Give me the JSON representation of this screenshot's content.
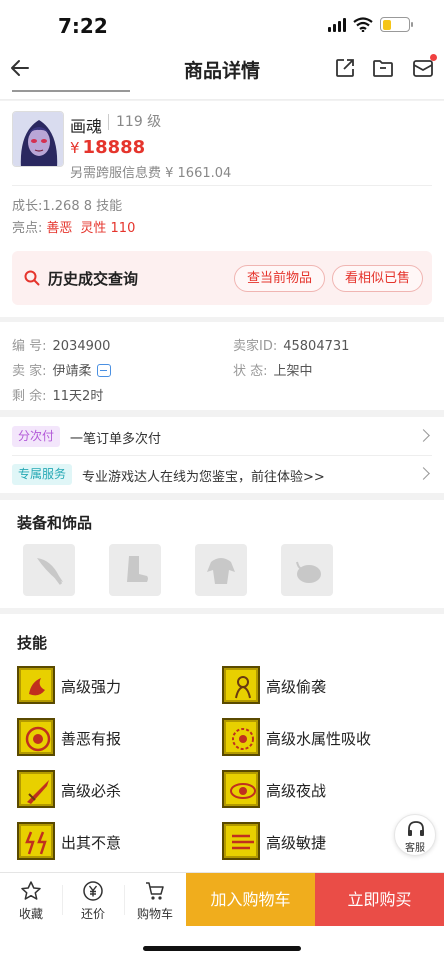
{
  "status": {
    "time": "7:22"
  },
  "nav": {
    "title": "商品详情"
  },
  "product": {
    "name": "画魂",
    "level": "119 级",
    "price_symbol": "¥",
    "price": "18888",
    "fee": "另需跨服信息费 ¥ 1661.04",
    "growth": "成长:1.268 8 技能",
    "highlight_label": "亮点:",
    "highlights": [
      "善恶",
      "灵性 110"
    ]
  },
  "history": {
    "title": "历史成交查询",
    "btn_current": "查当前物品",
    "btn_similar": "看相似已售"
  },
  "info": {
    "sn_label": "编 号:",
    "sn": "2034900",
    "seller_id_label": "卖家ID:",
    "seller_id": "45804731",
    "seller_label": "卖 家:",
    "seller": "伊靖柔",
    "status_label": "状 态:",
    "status": "上架中",
    "remain_label": "剩 余:",
    "remain": "11天2时"
  },
  "services": [
    {
      "tag": "分次付",
      "text": "一笔订单多次付"
    },
    {
      "tag": "专属服务",
      "text": "专业游戏达人在线为您鉴宝，前往体验>>"
    }
  ],
  "equipment": {
    "title": "装备和饰品",
    "slots": [
      "weapon-slot-icon",
      "boot-slot-icon",
      "armor-slot-icon",
      "accessory-slot-icon"
    ]
  },
  "skills": {
    "title": "技能",
    "items": [
      {
        "name": "高级强力"
      },
      {
        "name": "高级偷袭"
      },
      {
        "name": "善恶有报"
      },
      {
        "name": "高级水属性吸收"
      },
      {
        "name": "高级必杀"
      },
      {
        "name": "高级夜战"
      },
      {
        "name": "出其不意"
      },
      {
        "name": "高级敏捷"
      }
    ]
  },
  "customer_service": {
    "label": "客服"
  },
  "bottom": {
    "collect": "收藏",
    "bargain": "还价",
    "cart": "购物车",
    "add_cart": "加入购物车",
    "buy_now": "立即购买"
  },
  "colors": {
    "accent_red": "#e5342c",
    "cart_button": "#f0ad1d",
    "buy_button": "#ea4d47",
    "skill_icon": "#e8d000"
  }
}
